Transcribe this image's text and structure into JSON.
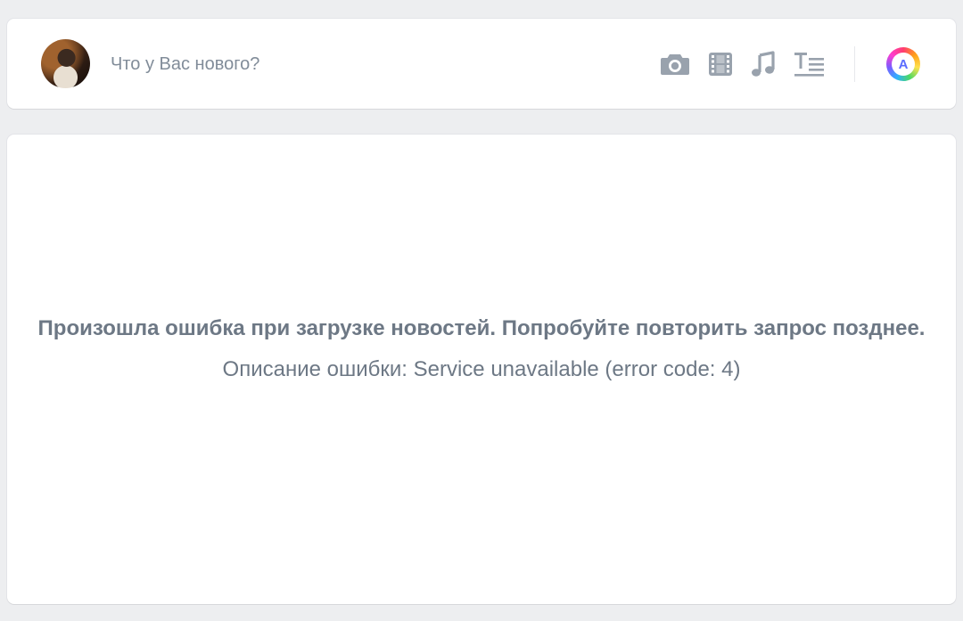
{
  "composer": {
    "placeholder": "Что у Вас нового?",
    "icon_color": "#99a2ad",
    "tools": [
      {
        "name": "photo",
        "icon": "camera-icon"
      },
      {
        "name": "video",
        "icon": "film-icon"
      },
      {
        "name": "music",
        "icon": "music-note-icon"
      },
      {
        "name": "article",
        "icon": "article-icon"
      }
    ],
    "app_badge": {
      "letter": "A",
      "icon": "app-launcher-icon"
    }
  },
  "feed_error": {
    "title": "Произошла ошибка при загрузке новостей. Попробуйте повторить запрос позднее.",
    "description": "Описание ошибки: Service unavailable (error code: 4)",
    "text_color": "#6d7885"
  },
  "colors": {
    "background": "#edeef0",
    "card": "#ffffff"
  }
}
